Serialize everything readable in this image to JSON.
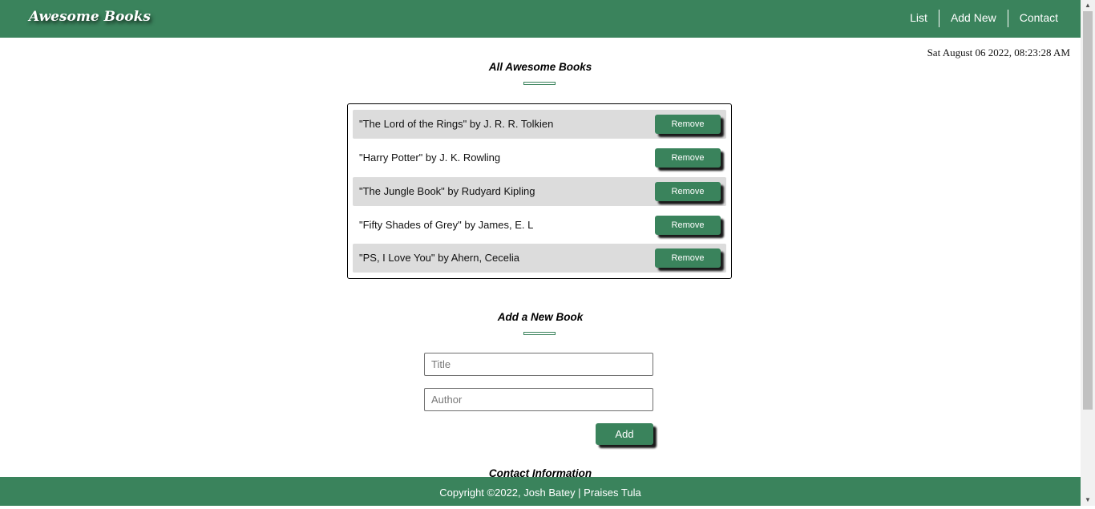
{
  "header": {
    "logo": "Awesome Books",
    "nav": [
      "List",
      "Add New",
      "Contact"
    ]
  },
  "datetime": "Sat August 06 2022, 08:23:28 AM",
  "list_section": {
    "title": "All Awesome Books",
    "books": [
      {
        "text": "\"The Lord of the Rings\" by J. R. R. Tolkien",
        "button": "Remove"
      },
      {
        "text": "\"Harry Potter\" by J. K. Rowling",
        "button": "Remove"
      },
      {
        "text": "\"The Jungle Book\" by Rudyard Kipling",
        "button": "Remove"
      },
      {
        "text": "\"Fifty Shades of Grey\" by James, E. L",
        "button": "Remove"
      },
      {
        "text": "\"PS, I Love You\" by Ahern, Cecelia",
        "button": "Remove"
      }
    ]
  },
  "add_section": {
    "title": "Add a New Book",
    "title_placeholder": "Title",
    "author_placeholder": "Author",
    "add_label": "Add"
  },
  "contact_section": {
    "title": "Contact Information"
  },
  "footer": {
    "text": "Copyright ©2022, Josh Batey | Praises Tula"
  },
  "colors": {
    "brand": "#3a835c",
    "row_shade": "#dcdcdc"
  }
}
